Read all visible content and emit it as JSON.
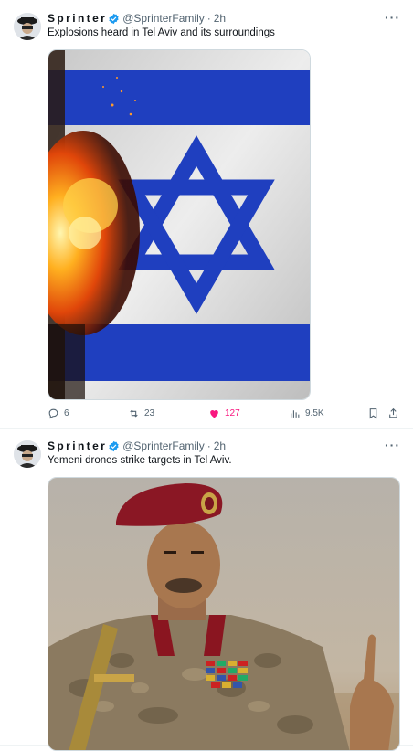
{
  "tweets": [
    {
      "author_name": "Sprinter",
      "handle": "@SprinterFamily",
      "separator": "·",
      "time": "2h",
      "text": "Explosions heard in Tel Aviv and its surroundings",
      "image": "israeli-flag-with-explosion",
      "stats": {
        "replies": "6",
        "retweets": "23",
        "likes": "127",
        "views": "9.5K"
      },
      "liked": true
    },
    {
      "author_name": "Sprinter",
      "handle": "@SprinterFamily",
      "separator": "·",
      "time": "2h",
      "text": "Yemeni drones strike targets in Tel Aviv.",
      "image": "military-officer-in-red-beret"
    }
  ],
  "more_label": "···",
  "colors": {
    "verified": "#1d9bf0",
    "like": "#f91880",
    "secondary": "#536471",
    "flag_blue": "#1f3fbf"
  }
}
